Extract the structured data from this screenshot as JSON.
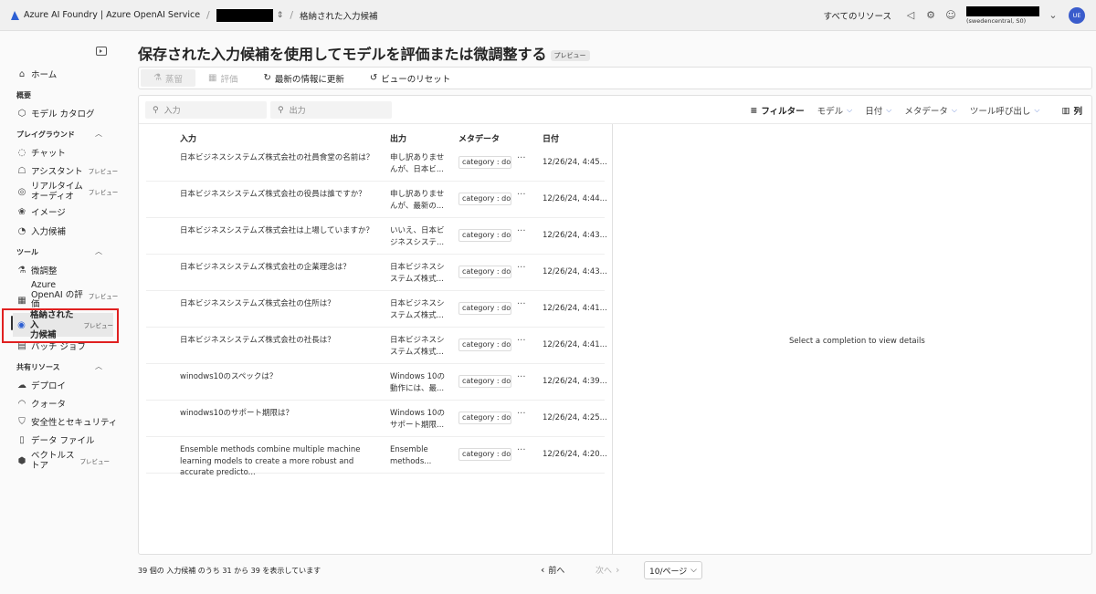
{
  "topbar": {
    "brand": "Azure AI Foundry | Azure OpenAI Service",
    "separator": "/",
    "current_page": "格納された入力候補",
    "all_resources": "すべてのリソース",
    "region": "(swedencentral, S0)",
    "avatar_initials": "UE",
    "chevron": "⌄"
  },
  "sidebar": {
    "home": "ホーム",
    "overview_section": "概要",
    "model_catalog": "モデル カタログ",
    "playground_section": "プレイグラウンド",
    "chat": "チャット",
    "assistant": "アシスタント",
    "realtime_audio_1": "リアルタイム",
    "realtime_audio_2": "オーディオ",
    "image": "イメージ",
    "completions": "入力候補",
    "tools_section": "ツール",
    "fine_tune": "微調整",
    "aoai_eval_1": "Azure",
    "aoai_eval_2": "OpenAI の評",
    "aoai_eval_3": "価",
    "stored_completions_1": "格納された入",
    "stored_completions_2": "力候補",
    "batch_jobs": "バッチ ジョブ",
    "shared_section": "共有リソース",
    "deploy": "デプロイ",
    "quota": "クォータ",
    "safety": "安全性とセキュリティ",
    "data_files": "データ ファイル",
    "vector_store_1": "ベクトルス",
    "vector_store_2": "トア",
    "preview_badge": "プレビュー"
  },
  "main": {
    "title": "保存された入力候補を使用してモデルを評価または微調整する",
    "title_badge": "プレビュー"
  },
  "toolbar": {
    "distill": "蒸留",
    "evaluate": "評価",
    "refresh": "最新の情報に更新",
    "reset_view": "ビューのリセット"
  },
  "filters": {
    "input_placeholder": "入力",
    "output_placeholder": "出力",
    "filter": "フィルター",
    "model": "モデル",
    "date": "日付",
    "metadata": "メタデータ",
    "tool_calls": "ツール呼び出し",
    "columns": "列"
  },
  "table": {
    "headers": {
      "input": "入力",
      "output": "出力",
      "metadata": "メタデータ",
      "date": "日付"
    },
    "more": "···",
    "rows": [
      {
        "input": "日本ビジネスシステムズ株式会社の社員食堂の名前は？",
        "output": "申し訳ありませんが、日本ビ...",
        "meta": "category : doc",
        "date": "12/26/24, 4:45..."
      },
      {
        "input": "日本ビジネスシステムズ株式会社の役員は誰ですか？",
        "output": "申し訳ありませんが、最新の...",
        "meta": "category : doc",
        "date": "12/26/24, 4:44..."
      },
      {
        "input": "日本ビジネスシステムズ株式会社は上場していますか？",
        "output": "いいえ、日本ビジネスシステ...",
        "meta": "category : doc",
        "date": "12/26/24, 4:43..."
      },
      {
        "input": "日本ビジネスシステムズ株式会社の企業理念は？",
        "output": "日本ビジネスシステムズ株式...",
        "meta": "category : doc",
        "date": "12/26/24, 4:43..."
      },
      {
        "input": "日本ビジネスシステムズ株式会社の住所は？",
        "output": "日本ビジネスシステムズ株式...",
        "meta": "category : doc",
        "date": "12/26/24, 4:41..."
      },
      {
        "input": "日本ビジネスシステムズ株式会社の社長は？",
        "output": "日本ビジネスシステムズ株式...",
        "meta": "category : doc",
        "date": "12/26/24, 4:41..."
      },
      {
        "input": "winodws10のスペックは？",
        "output": "Windows 10の動作には、最...",
        "meta": "category : doc",
        "date": "12/26/24, 4:39..."
      },
      {
        "input": "winodws10のサポート期限は？",
        "output": "Windows 10のサポート期限...",
        "meta": "category : doc",
        "date": "12/26/24, 4:25..."
      },
      {
        "input": "Ensemble methods combine multiple machine learning models to create a more robust and accurate predicto...",
        "output": "Ensemble methods...",
        "meta": "category : doc",
        "date": "12/26/24, 4:20..."
      }
    ]
  },
  "detail": {
    "empty": "Select a completion to view details"
  },
  "footer": {
    "count": "39 個の 入力候補 のうち 31 から 39 を表示しています",
    "prev": "前へ",
    "next": "次へ",
    "page_size": "10/ページ"
  }
}
